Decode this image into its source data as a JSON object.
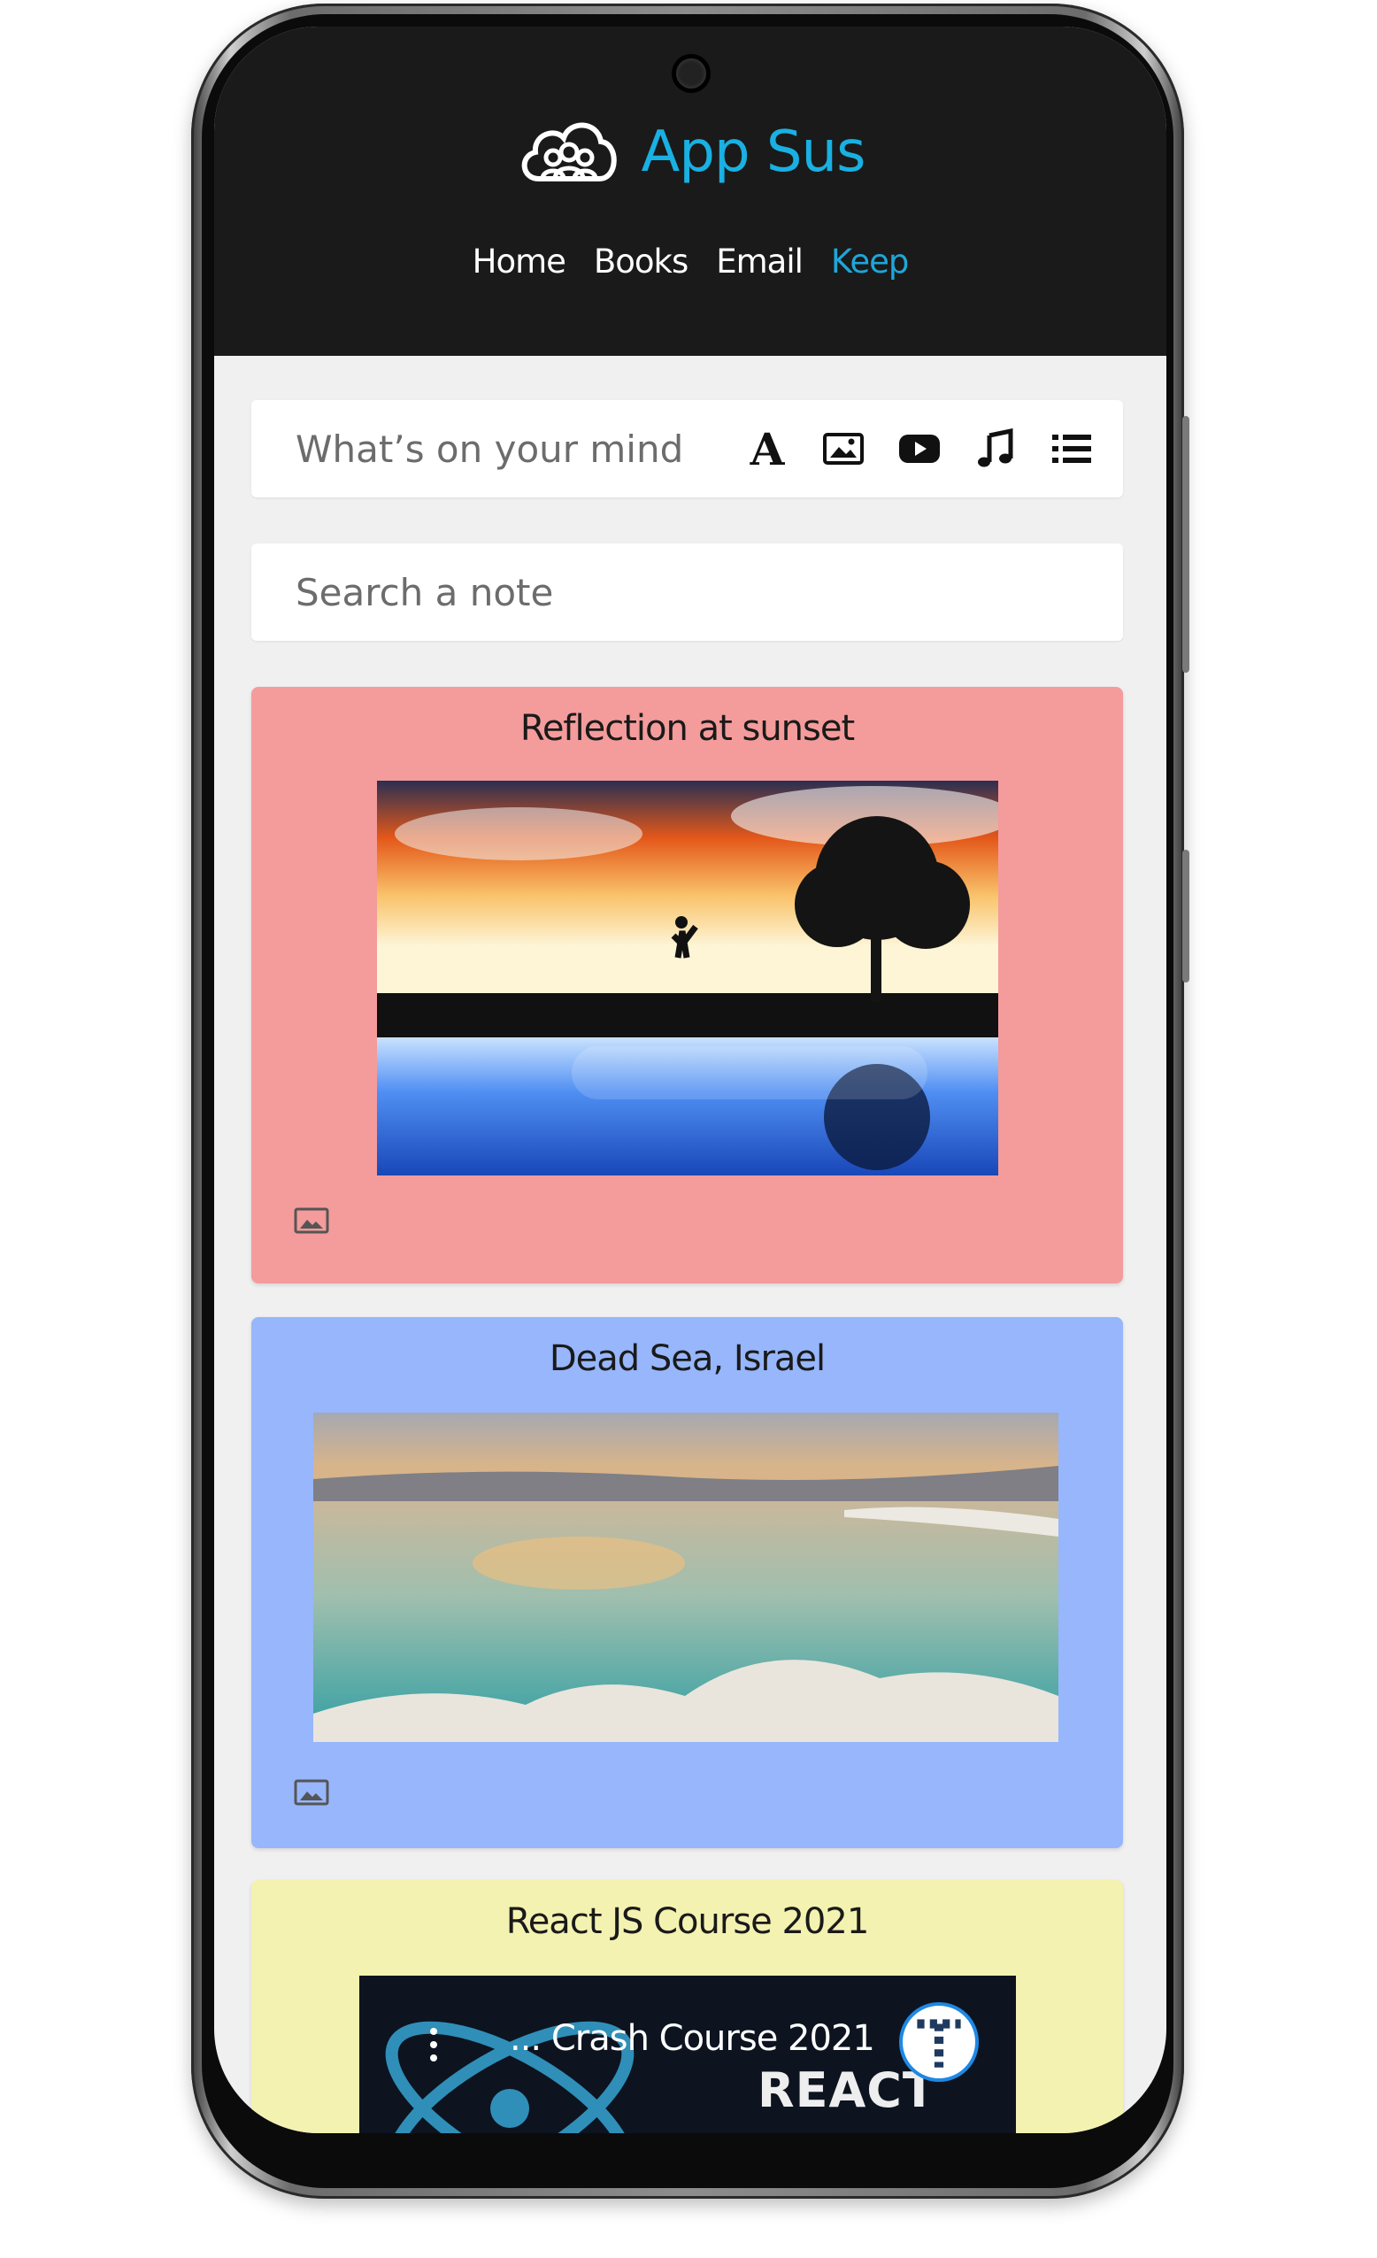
{
  "app": {
    "title": "App Sus",
    "logo_icon": "cloud-users-icon",
    "accent_color": "#19b0e2"
  },
  "nav": {
    "items": [
      {
        "label": "Home",
        "active": false
      },
      {
        "label": "Books",
        "active": false
      },
      {
        "label": "Email",
        "active": false
      },
      {
        "label": "Keep",
        "active": true
      }
    ]
  },
  "composer": {
    "placeholder": "What’s on your mind",
    "tools": [
      {
        "icon": "text-icon",
        "glyph": "A"
      },
      {
        "icon": "image-icon"
      },
      {
        "icon": "video-icon"
      },
      {
        "icon": "music-note-icon"
      },
      {
        "icon": "list-icon"
      }
    ]
  },
  "search": {
    "placeholder": "Search a note"
  },
  "notes": [
    {
      "title": "Reflection at sunset",
      "type": "image",
      "color": "#f49b9b",
      "type_icon": "image-icon"
    },
    {
      "title": "Dead Sea, Israel",
      "type": "image",
      "color": "#97b6fb",
      "type_icon": "image-icon"
    },
    {
      "title": "React JS Course 2021",
      "type": "video",
      "color": "#f3f2b1",
      "video_title": "... Crash Course 2021",
      "video_logo_text": "REACT"
    }
  ]
}
